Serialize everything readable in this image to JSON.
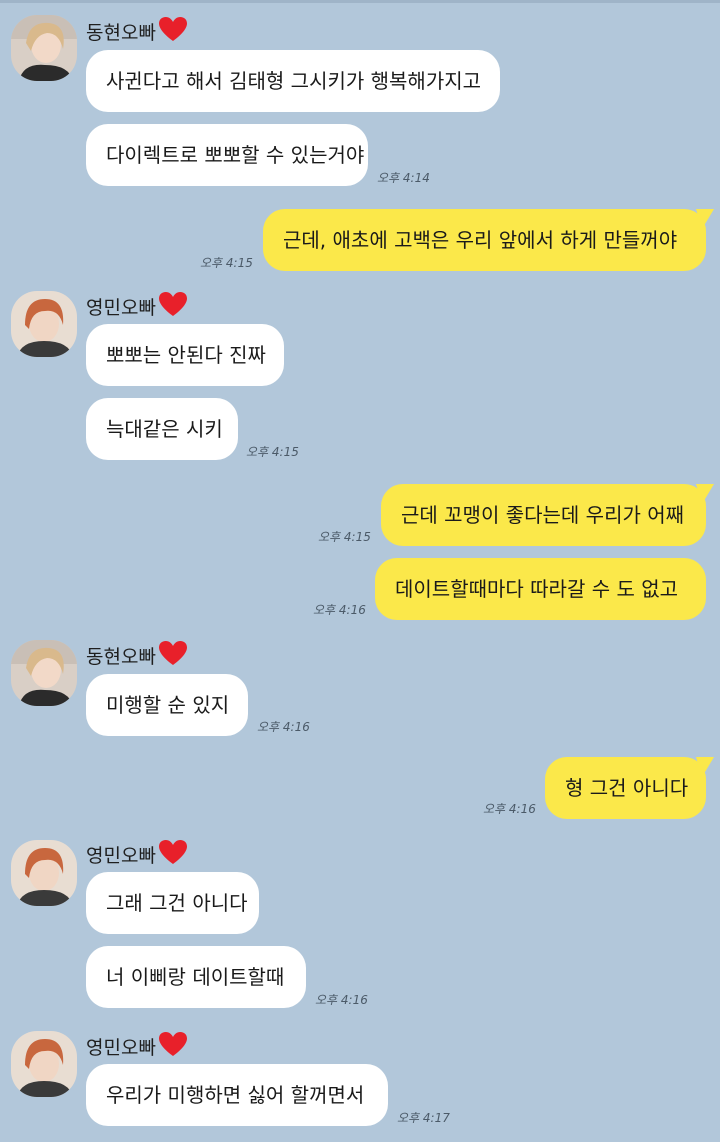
{
  "messages": [
    {
      "type": "sender",
      "name": "동현오빠"
    },
    {
      "type": "in",
      "text": "사귄다고 해서 김태형 그시키가 행복해가지고"
    },
    {
      "type": "in",
      "text": "다이렉트로 뽀뽀할 수 있는거야",
      "time": "오후 4:14"
    },
    {
      "type": "out",
      "text": "근데, 애초에 고백은 우리 앞에서 하게 만들꺼야",
      "time": "오후 4:15"
    },
    {
      "type": "sender",
      "name": "영민오빠"
    },
    {
      "type": "in",
      "text": "뽀뽀는 안된다 진짜"
    },
    {
      "type": "in",
      "text": "늑대같은 시키",
      "time": "오후 4:15"
    },
    {
      "type": "out",
      "text": "근데 꼬맹이 좋다는데 우리가 어째",
      "time": "오후 4:15"
    },
    {
      "type": "out",
      "text": "데이트할때마다 따라갈 수 도 없고",
      "time": "오후 4:16"
    },
    {
      "type": "sender",
      "name": "동현오빠"
    },
    {
      "type": "in",
      "text": "미행할 순 있지",
      "time": "오후 4:16"
    },
    {
      "type": "out",
      "text": "형 그건 아니다",
      "time": "오후 4:16"
    },
    {
      "type": "sender",
      "name": "영민오빠"
    },
    {
      "type": "in",
      "text": "그래 그건 아니다"
    },
    {
      "type": "in",
      "text": "너 이삐랑 데이트할때",
      "time": "오후 4:16"
    },
    {
      "type": "sender",
      "name": "영민오빠"
    },
    {
      "type": "in",
      "text": "우리가 미행하면 싫어 할꺼면서",
      "time": "오후 4:17"
    }
  ],
  "colors": {
    "background": "#b2c7da",
    "outgoing": "#fbe84a",
    "incoming": "#ffffff",
    "heart": "#e8202a"
  },
  "icons": {
    "heart": "heart-icon",
    "avatar": "avatar"
  }
}
